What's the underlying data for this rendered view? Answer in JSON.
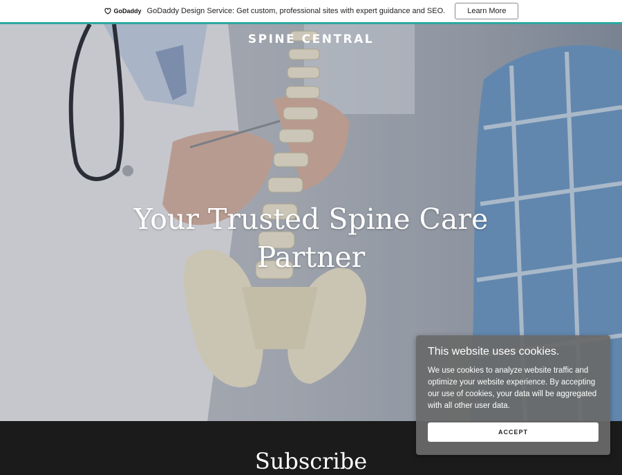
{
  "promo": {
    "logo_text": "GoDaddy",
    "message": "GoDaddy Design Service: Get custom, professional sites with expert guidance and SEO.",
    "cta_label": "Learn More"
  },
  "header": {
    "brand": "SPINE CENTRAL"
  },
  "hero": {
    "headline": "Your Trusted Spine Care Partner"
  },
  "subscribe": {
    "title": "Subscribe"
  },
  "cookie_banner": {
    "title": "This website uses cookies.",
    "body": "We use cookies to analyze website traffic and optimize your website experience. By accepting our use of cookies, your data will be aggregated with all other user data.",
    "accept_label": "ACCEPT"
  },
  "colors": {
    "accent_bar": "#2aa8a0",
    "footer_bg": "#1b1b1b",
    "cookie_bg": "#696969"
  },
  "icons": {
    "logo": "godaddy-logo-icon"
  }
}
